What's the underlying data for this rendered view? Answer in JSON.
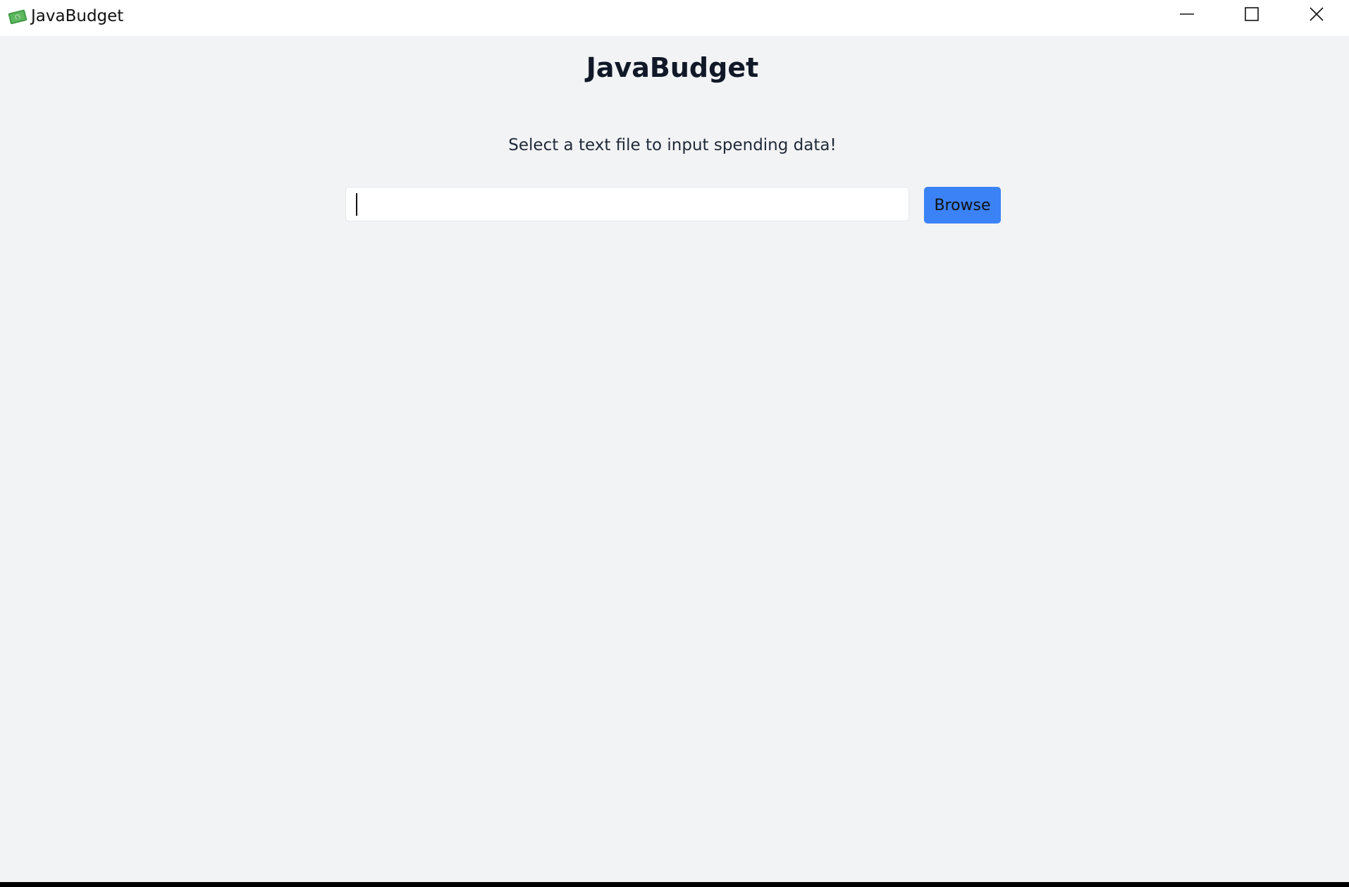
{
  "window": {
    "title": "JavaBudget",
    "app_icon": "money-bill-icon",
    "controls": {
      "minimize_icon": "minimize-icon",
      "maximize_icon": "maximize-icon",
      "close_icon": "close-icon"
    }
  },
  "main": {
    "heading": "JavaBudget",
    "instruction": "Select a text file to input spending data!",
    "file_input": {
      "value": "",
      "placeholder": ""
    },
    "browse_label": "Browse"
  },
  "colors": {
    "background": "#f2f3f5",
    "titlebar": "#ffffff",
    "accent_button": "#3b82f6",
    "icon_green": "#4caf50"
  }
}
